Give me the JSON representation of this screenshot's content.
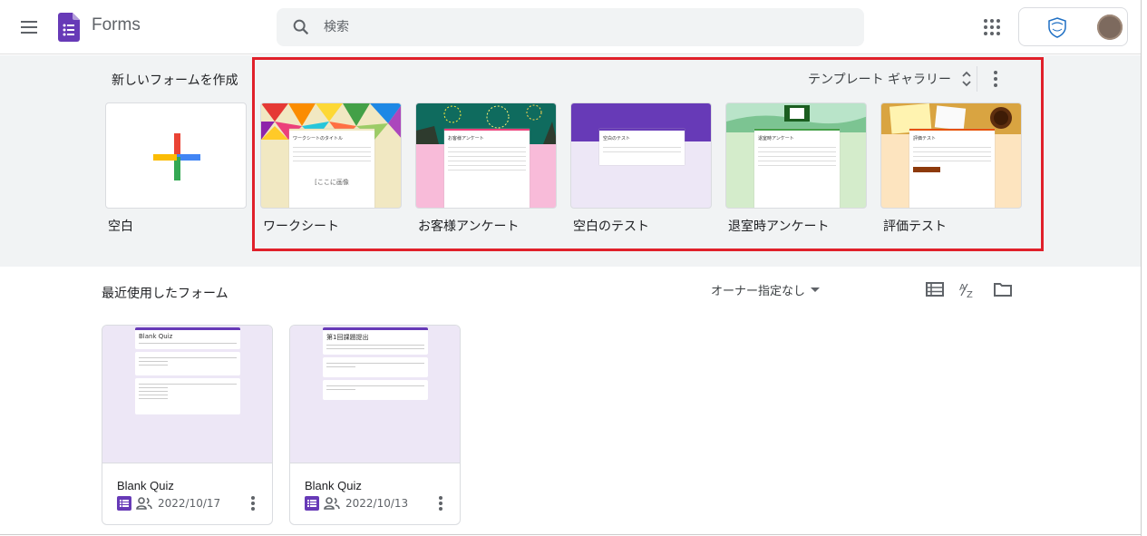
{
  "header": {
    "app_title": "Forms",
    "search_placeholder": "検索"
  },
  "templates": {
    "section_title": "新しいフォームを作成",
    "gallery_label": "テンプレート ギャラリー",
    "items": [
      {
        "label": "空白"
      },
      {
        "label": "ワークシート",
        "card_title": "ワークシートのタイトル",
        "image_caption": "[ここに画像"
      },
      {
        "label": "お客様アンケート",
        "card_title": "お客様アンケート"
      },
      {
        "label": "空白のテスト",
        "card_title": "空白のテスト"
      },
      {
        "label": "退室時アンケート",
        "card_title": "退室時アンケート"
      },
      {
        "label": "評価テスト",
        "card_title": "評価テスト"
      }
    ]
  },
  "recent": {
    "section_title": "最近使用したフォーム",
    "owner_filter": "オーナー指定なし",
    "forms": [
      {
        "name": "Blank Quiz",
        "date": "2022/10/17",
        "thumb_title": "Blank Quiz"
      },
      {
        "name": "Blank Quiz",
        "date": "2022/10/13",
        "thumb_title": "第1回課題提出"
      }
    ]
  },
  "colors": {
    "forms_purple": "#673ab7",
    "highlight_red": "#e0202a",
    "template_bg": "#f1f3f4"
  }
}
